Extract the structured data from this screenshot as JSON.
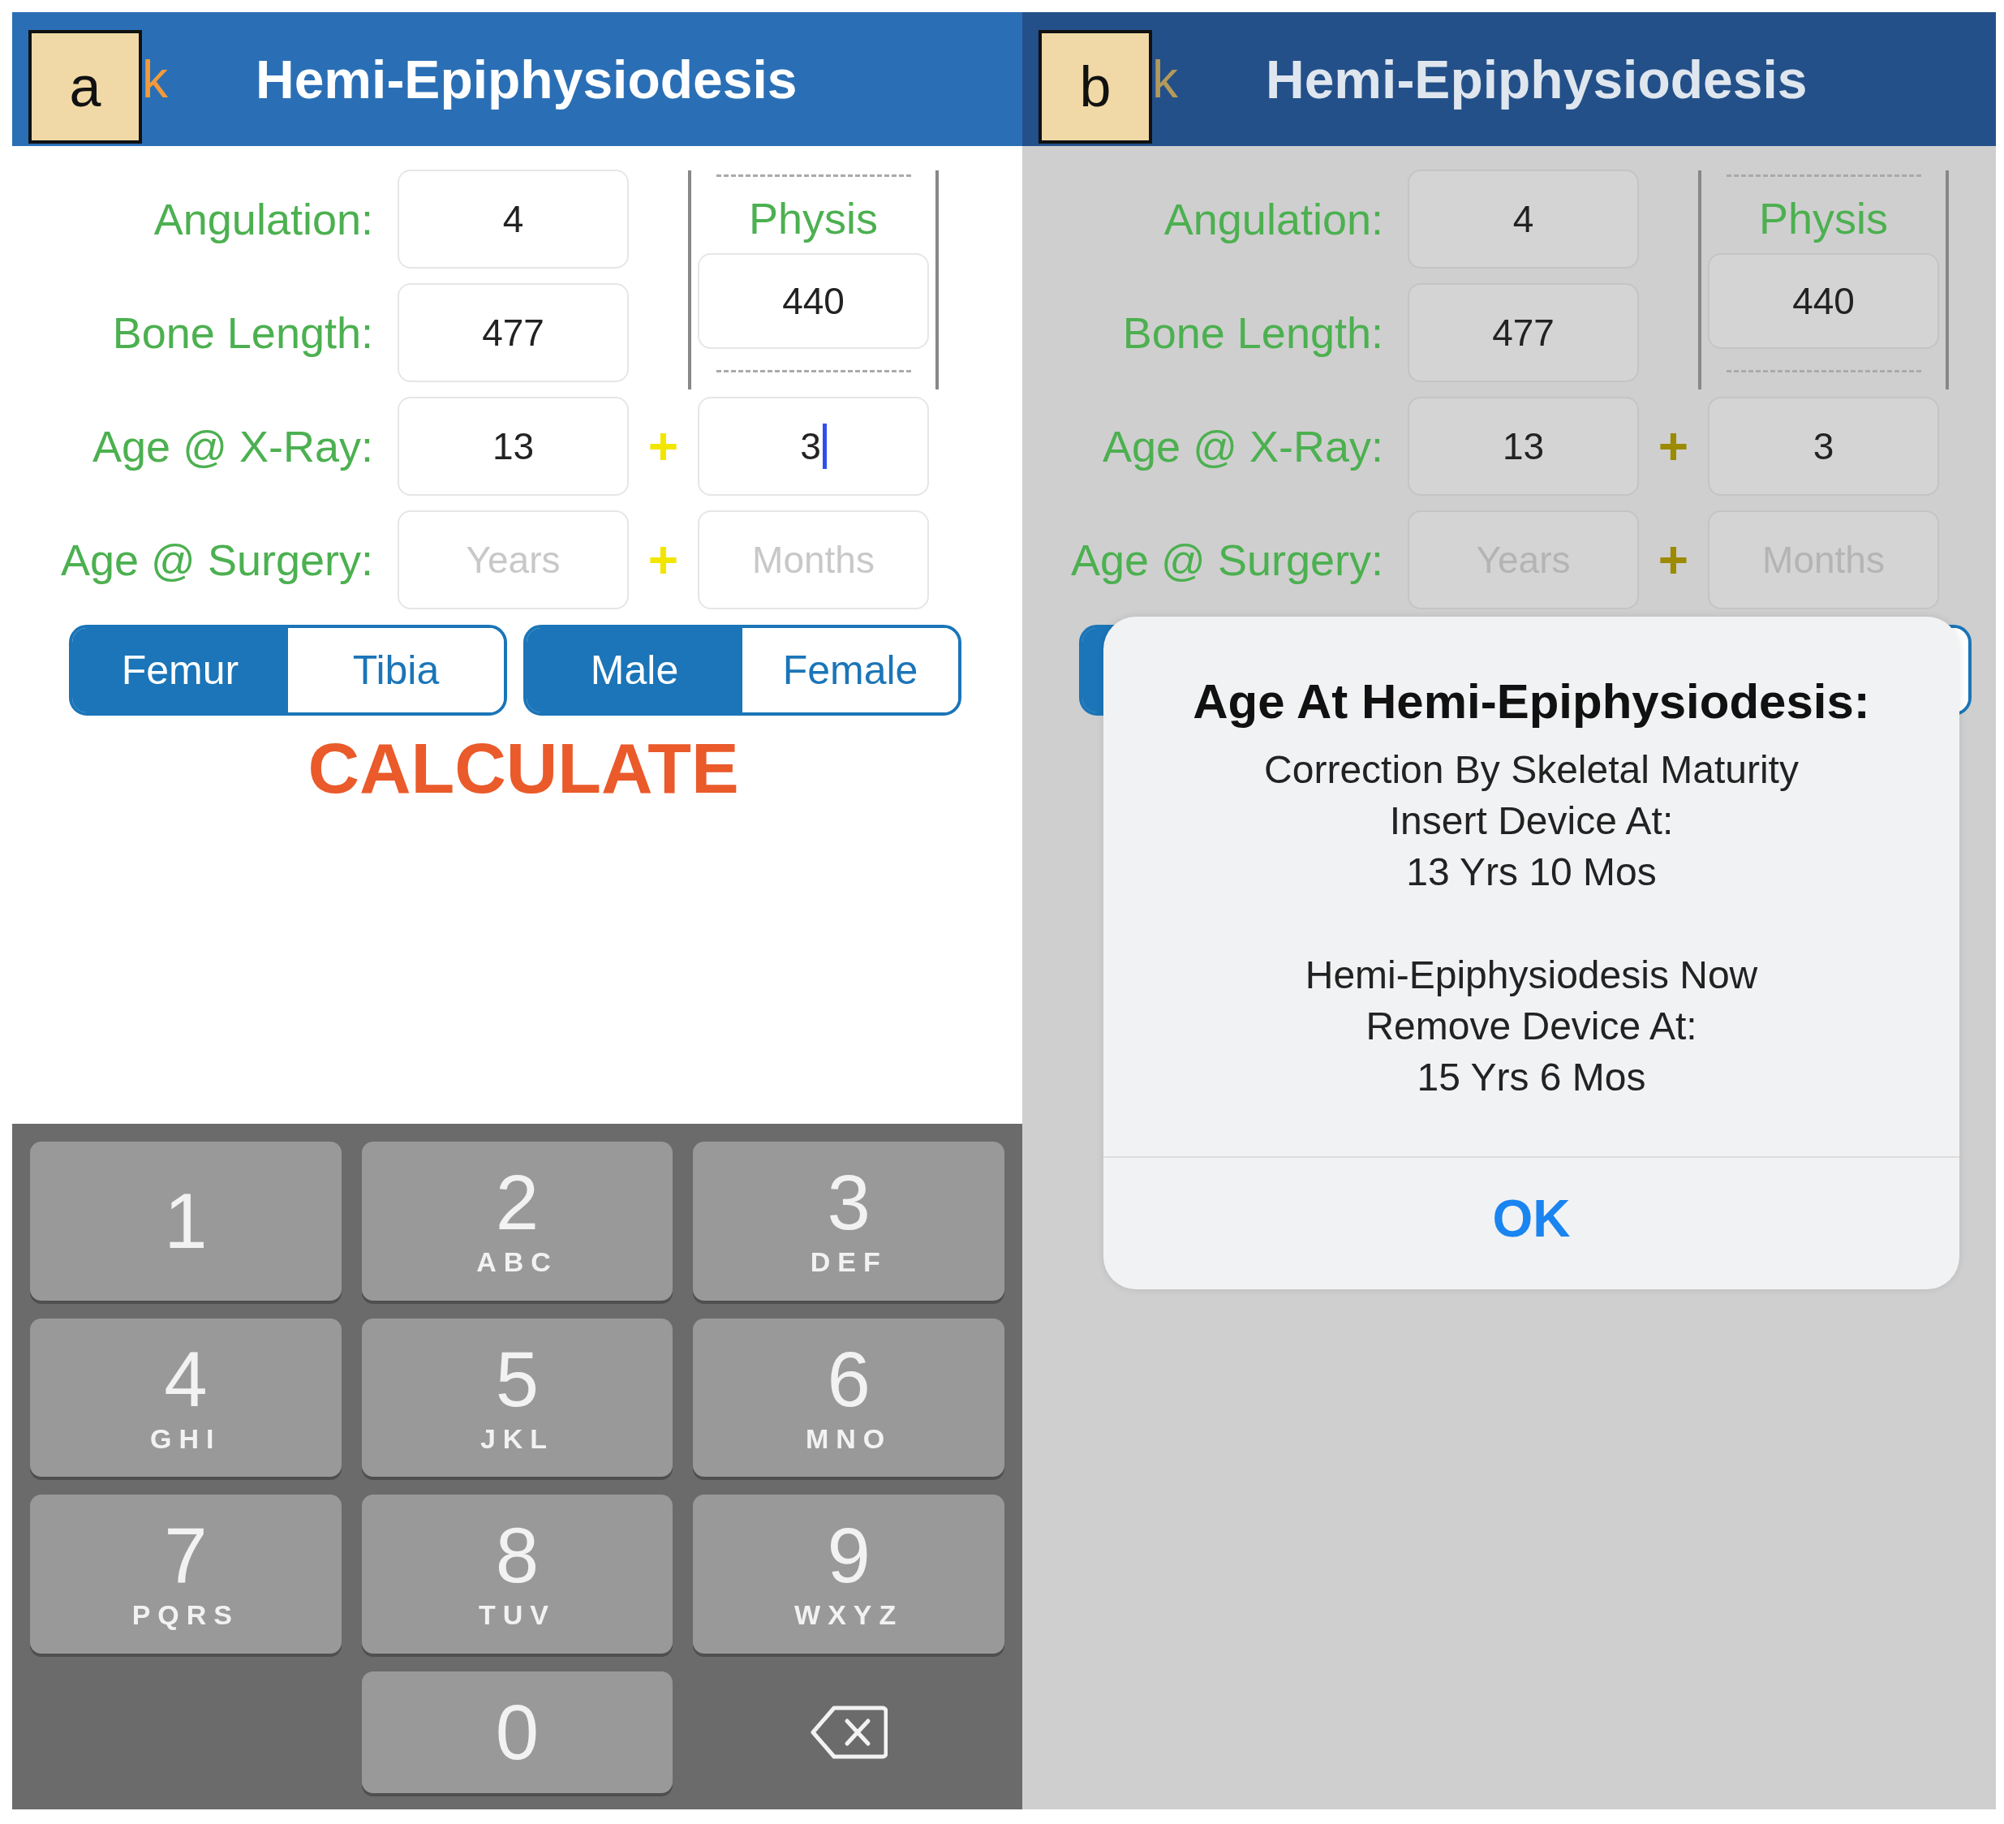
{
  "panels": [
    {
      "label": "a",
      "header": {
        "back": "k",
        "title": "Hemi-Epiphysiodesis"
      },
      "form": {
        "rows": [
          {
            "label": "Angulation:",
            "fields": [
              {
                "value": "4",
                "focused": false
              }
            ]
          },
          {
            "label": "Bone Length:",
            "fields": [
              {
                "value": "477",
                "focused": false
              }
            ]
          },
          {
            "label": "Age @ X-Ray:",
            "plus": "+",
            "fields": [
              {
                "value": "13",
                "focused": false
              },
              {
                "value": "3",
                "focused": true
              }
            ]
          },
          {
            "label": "Age @ Surgery:",
            "plus": "+",
            "fields": [
              {
                "placeholder": "Years"
              },
              {
                "placeholder": "Months"
              }
            ]
          }
        ],
        "physis": {
          "label": "Physis",
          "value": "440"
        }
      },
      "segments": [
        [
          {
            "label": "Femur",
            "selected": true
          },
          {
            "label": "Tibia",
            "selected": false
          }
        ],
        [
          {
            "label": "Male",
            "selected": true
          },
          {
            "label": "Female",
            "selected": false
          }
        ]
      ],
      "calculate": "CALCULATE",
      "keypad": [
        {
          "kind": "digit",
          "digit": "1"
        },
        {
          "kind": "digit",
          "digit": "2",
          "letters": "ABC"
        },
        {
          "kind": "digit",
          "digit": "3",
          "letters": "DEF"
        },
        {
          "kind": "digit",
          "digit": "4",
          "letters": "GHI"
        },
        {
          "kind": "digit",
          "digit": "5",
          "letters": "JKL"
        },
        {
          "kind": "digit",
          "digit": "6",
          "letters": "MNO"
        },
        {
          "kind": "digit",
          "digit": "7",
          "letters": "PQRS"
        },
        {
          "kind": "digit",
          "digit": "8",
          "letters": "TUV"
        },
        {
          "kind": "digit",
          "digit": "9",
          "letters": "WXYZ"
        },
        {
          "kind": "blank"
        },
        {
          "kind": "digit",
          "digit": "0"
        },
        {
          "kind": "delete"
        }
      ]
    },
    {
      "label": "b",
      "header": {
        "back": "k",
        "title": "Hemi-Epiphysiodesis"
      },
      "form": {
        "rows": [
          {
            "label": "Angulation:",
            "fields": [
              {
                "value": "4",
                "focused": false
              }
            ]
          },
          {
            "label": "Bone Length:",
            "fields": [
              {
                "value": "477",
                "focused": false
              }
            ]
          },
          {
            "label": "Age @ X-Ray:",
            "plus": "+",
            "fields": [
              {
                "value": "13",
                "focused": false
              },
              {
                "value": "3",
                "focused": false
              }
            ]
          },
          {
            "label": "Age @ Surgery:",
            "plus": "+",
            "fields": [
              {
                "placeholder": "Years"
              },
              {
                "placeholder": "Months"
              }
            ]
          }
        ],
        "physis": {
          "label": "Physis",
          "value": "440"
        }
      },
      "segments": [
        [
          {
            "selected": true
          }
        ],
        [
          {
            "selected": false
          }
        ]
      ],
      "alert": {
        "title": "Age At Hemi-Epiphysiodesis:",
        "paragraphs": [
          [
            "Correction By Skeletal Maturity",
            "Insert Device At:",
            "13 Yrs 10 Mos"
          ],
          [
            "Hemi-Epiphysiodesis Now",
            "Remove Device At:",
            "15 Yrs 6 Mos"
          ]
        ],
        "button": "OK"
      }
    }
  ]
}
